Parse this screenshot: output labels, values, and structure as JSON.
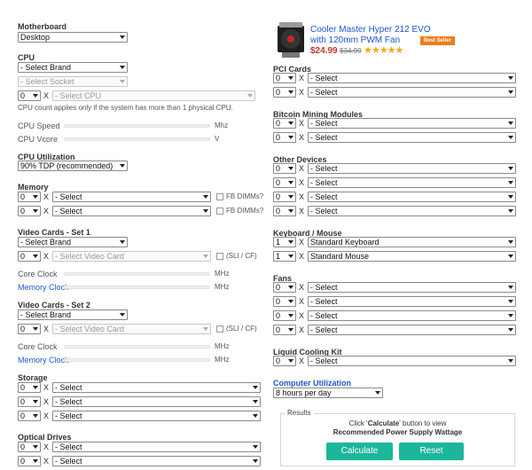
{
  "motherboard": {
    "label": "Motherboard",
    "value": "Desktop"
  },
  "cpu": {
    "label": "CPU",
    "brand": "- Select Brand",
    "socket": "- Select Socket",
    "count": "0",
    "x": "X",
    "model": "- Select CPU",
    "note": "CPU count applies only if the system has more than 1 physical CPU.",
    "speed_label": "CPU Speed",
    "speed_unit": "Mhz",
    "vcore_label": "CPU Vcore",
    "vcore_unit": "V"
  },
  "cpu_utilization": {
    "label": "CPU Utilization",
    "value": "90% TDP (recommended)"
  },
  "memory": {
    "label": "Memory",
    "rows": [
      {
        "count": "0",
        "value": "- Select",
        "fb": "FB DIMMs?"
      },
      {
        "count": "0",
        "value": "- Select",
        "fb": "FB DIMMs?"
      }
    ]
  },
  "video1": {
    "label": "Video Cards - Set 1",
    "brand": "- Select Brand",
    "count": "0",
    "card": "- Select Video Card",
    "sli": "(SLI / CF)",
    "core_label": "Core Clock",
    "core_unit": "MHz",
    "mem_label": "Memory Clock",
    "mem_unit": "MHz"
  },
  "video2": {
    "label": "Video Cards - Set 2",
    "brand": "- Select Brand",
    "count": "0",
    "card": "- Select Video Card",
    "sli": "(SLI / CF)",
    "core_label": "Core Clock",
    "core_unit": "MHz",
    "mem_label": "Memory Clock",
    "mem_unit": "MHz"
  },
  "storage": {
    "label": "Storage",
    "rows": [
      {
        "count": "0",
        "value": "- Select"
      },
      {
        "count": "0",
        "value": "- Select"
      },
      {
        "count": "0",
        "value": "- Select"
      }
    ]
  },
  "optical": {
    "label": "Optical Drives",
    "rows": [
      {
        "count": "0",
        "value": "- Select"
      },
      {
        "count": "0",
        "value": "- Select"
      }
    ]
  },
  "ad": {
    "title_line1": "Cooler Master Hyper 212 EVO",
    "title_line2": "with 120mm PWM Fan",
    "price": "$24.99",
    "old_price": "$34.99",
    "stars": "★★★★★",
    "badge": "Best Seller"
  },
  "pci": {
    "label": "PCI Cards",
    "rows": [
      {
        "count": "0",
        "value": "- Select"
      },
      {
        "count": "0",
        "value": "- Select"
      }
    ]
  },
  "bitcoin": {
    "label": "Bitcoin Mining Modules",
    "rows": [
      {
        "count": "0",
        "value": "- Select"
      },
      {
        "count": "0",
        "value": "- Select"
      }
    ]
  },
  "other": {
    "label": "Other Devices",
    "rows": [
      {
        "count": "0",
        "value": "- Select"
      },
      {
        "count": "0",
        "value": "- Select"
      },
      {
        "count": "0",
        "value": "- Select"
      },
      {
        "count": "0",
        "value": "- Select"
      }
    ]
  },
  "keyboard": {
    "label": "Keyboard / Mouse",
    "rows": [
      {
        "count": "1",
        "value": "Standard Keyboard"
      },
      {
        "count": "1",
        "value": "Standard Mouse"
      }
    ]
  },
  "fans": {
    "label": "Fans",
    "rows": [
      {
        "count": "0",
        "value": "- Select"
      },
      {
        "count": "0",
        "value": "- Select"
      },
      {
        "count": "0",
        "value": "- Select"
      },
      {
        "count": "0",
        "value": "- Select"
      }
    ]
  },
  "liquid": {
    "label": "Liquid Cooling Kit",
    "rows": [
      {
        "count": "0",
        "value": "- Select"
      }
    ]
  },
  "computer_utilization": {
    "label": "Computer Utilization",
    "value": "8 hours per day"
  },
  "results": {
    "legend": "Results",
    "line1_pre": "Click '",
    "line1_bold": "Calculate",
    "line1_post": "' button to view",
    "line2": "Recommended Power Supply Wattage",
    "calculate": "Calculate",
    "reset": "Reset"
  },
  "x_symbol": "X",
  "colors": {
    "accent": "#1cb79a",
    "link": "#2255cc",
    "badge": "#f07c1e",
    "price": "#c0392b"
  }
}
